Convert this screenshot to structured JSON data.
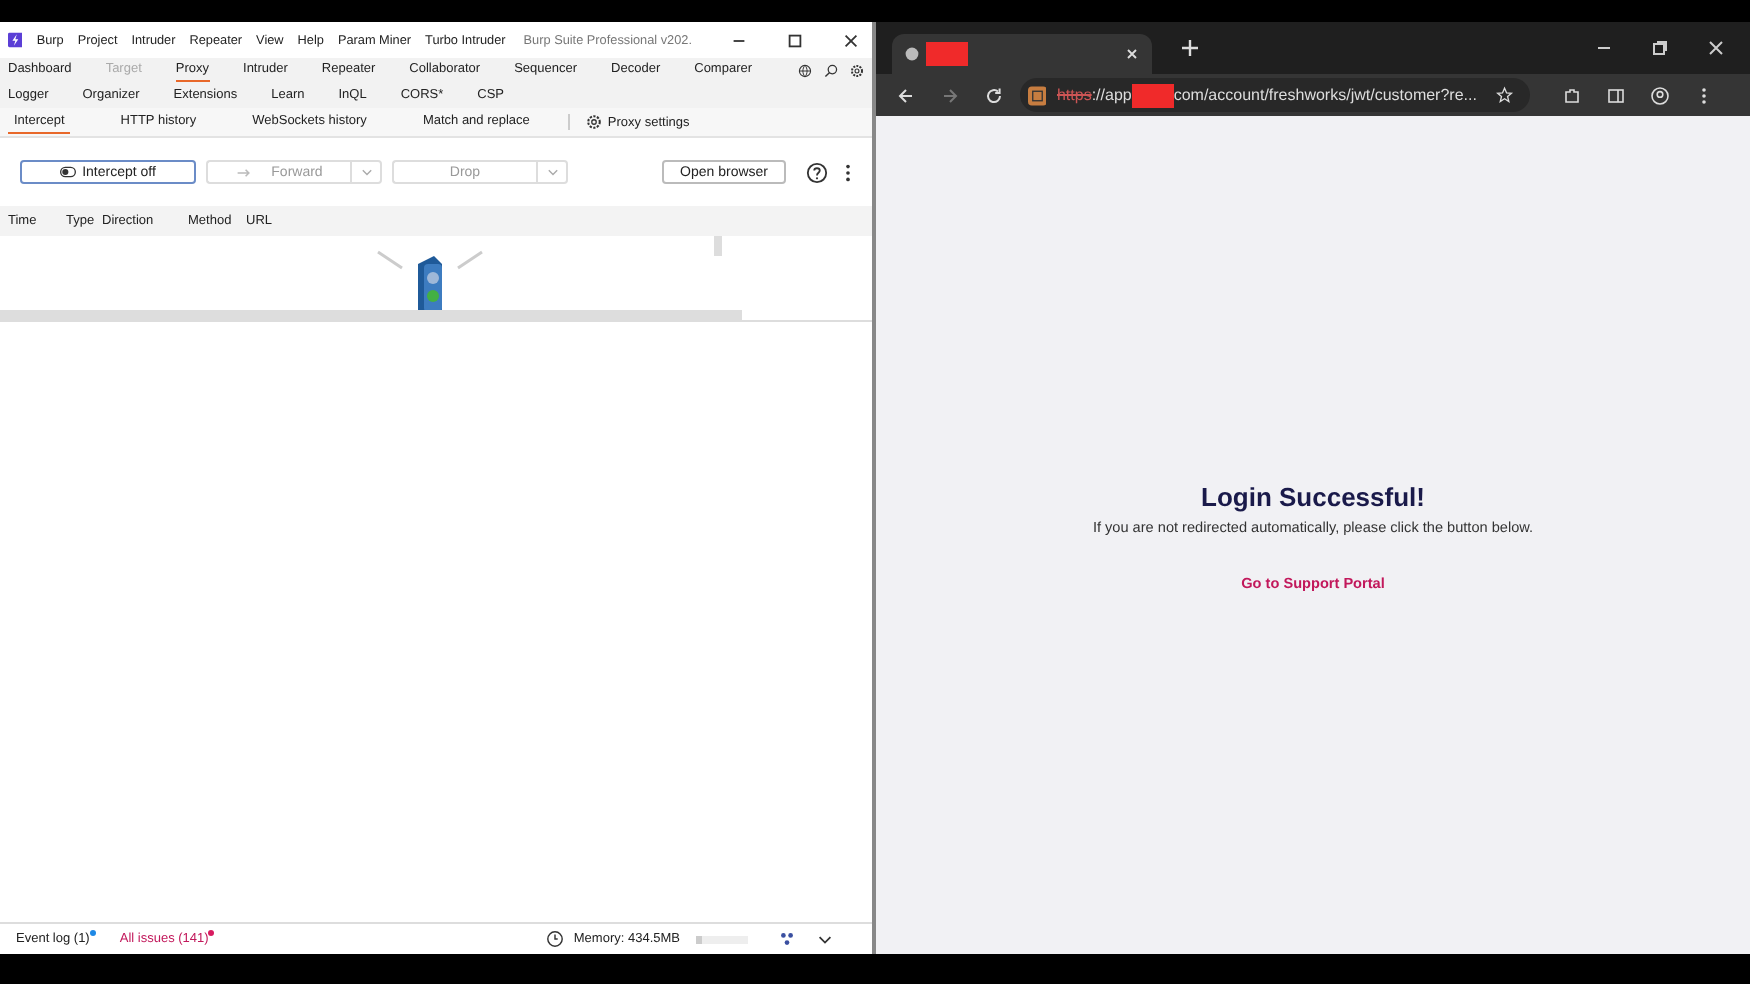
{
  "burp": {
    "menu": [
      "Burp",
      "Project",
      "Intruder",
      "Repeater",
      "View",
      "Help",
      "Param Miner",
      "Turbo Intruder"
    ],
    "title": "Burp Suite Professional v202.",
    "tab_rows": [
      [
        {
          "label": "Dashboard",
          "selected": false,
          "disabled": false
        },
        {
          "label": "Target",
          "selected": false,
          "disabled": true
        },
        {
          "label": "Proxy",
          "selected": true,
          "disabled": false
        },
        {
          "label": "Intruder",
          "selected": false,
          "disabled": false
        },
        {
          "label": "Repeater",
          "selected": false,
          "disabled": false
        },
        {
          "label": "Collaborator",
          "selected": false,
          "disabled": false
        },
        {
          "label": "Sequencer",
          "selected": false,
          "disabled": false
        },
        {
          "label": "Decoder",
          "selected": false,
          "disabled": false
        },
        {
          "label": "Comparer",
          "selected": false,
          "disabled": false
        }
      ],
      [
        {
          "label": "Logger",
          "selected": false,
          "disabled": false
        },
        {
          "label": "Organizer",
          "selected": false,
          "disabled": false
        },
        {
          "label": "Extensions",
          "selected": false,
          "disabled": false
        },
        {
          "label": "Learn",
          "selected": false,
          "disabled": false
        },
        {
          "label": "InQL",
          "selected": false,
          "disabled": false
        },
        {
          "label": "CORS*",
          "selected": false,
          "disabled": false
        },
        {
          "label": "CSP",
          "selected": false,
          "disabled": false
        }
      ]
    ],
    "subtabs": [
      {
        "label": "Intercept",
        "selected": true
      },
      {
        "label": "HTTP history",
        "selected": false
      },
      {
        "label": "WebSockets history",
        "selected": false
      },
      {
        "label": "Match and replace",
        "selected": false
      }
    ],
    "proxy_settings": "Proxy settings",
    "intercept_button": "Intercept off",
    "forward_button": {
      "label": "Forward",
      "disabled": true
    },
    "drop_button": {
      "label": "Drop",
      "disabled": true
    },
    "open_browser": "Open browser",
    "columns": [
      "Time",
      "Type",
      "Direction",
      "Method",
      "URL"
    ],
    "status": {
      "event_log": "Event log (1)",
      "all_issues": "All issues (141)",
      "memory": "Memory: 434.5MB",
      "memory_bar": {
        "level": 0.1
      }
    }
  },
  "browser": {
    "url_scheme": "https",
    "url_start": "://app",
    "url_end": "com/account/freshworks/jwt/customer?re...",
    "heading": "Login Successful!",
    "message": "If you are not redirected automatically, please click the button below.",
    "link": "Go to Support Portal"
  }
}
